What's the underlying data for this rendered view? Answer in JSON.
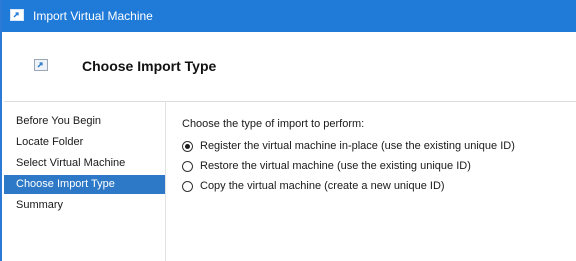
{
  "window": {
    "title": "Import Virtual Machine",
    "title_icon": "import-vm-icon",
    "titlebar_color": "#1f7ad8"
  },
  "header": {
    "title": "Choose Import Type",
    "icon": "import-vm-icon"
  },
  "sidebar": {
    "items": [
      {
        "label": "Before You Begin",
        "active": false
      },
      {
        "label": "Locate Folder",
        "active": false
      },
      {
        "label": "Select Virtual Machine",
        "active": false
      },
      {
        "label": "Choose Import Type",
        "active": true
      },
      {
        "label": "Summary",
        "active": false
      }
    ],
    "active_color": "#2d79c7"
  },
  "main": {
    "prompt": "Choose the type of import to perform:",
    "options": [
      {
        "label": "Register the virtual machine in-place (use the existing unique ID)",
        "selected": true
      },
      {
        "label": "Restore the virtual machine (use the existing unique ID)",
        "selected": false
      },
      {
        "label": "Copy the virtual machine (create a new unique ID)",
        "selected": false
      }
    ]
  }
}
